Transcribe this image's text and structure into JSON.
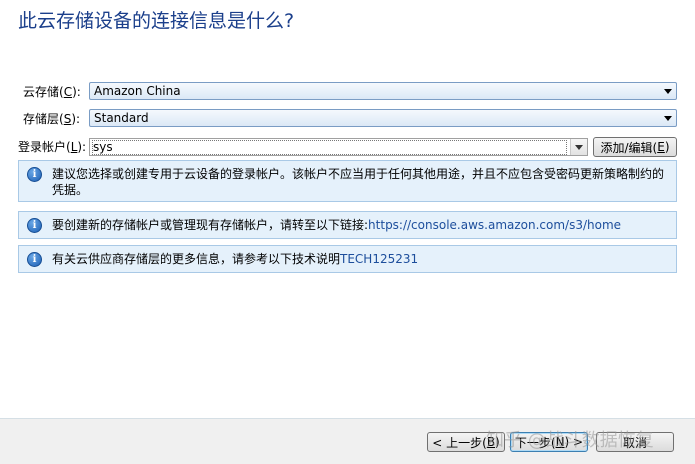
{
  "page": {
    "heading": "此云存储设备的连接信息是什么?"
  },
  "form": {
    "cloud_storage": {
      "label_prefix": "云存储(",
      "label_key": "C",
      "label_suffix": "):",
      "value": "Amazon China"
    },
    "storage_tier": {
      "label_prefix": "存储层(",
      "label_key": "S",
      "label_suffix": "):",
      "value": "Standard"
    },
    "login_account": {
      "label_prefix": "登录帐户(",
      "label_key": "L",
      "label_suffix": "):",
      "value": "sys"
    },
    "add_edit_button": {
      "label_prefix": "添加/编辑(",
      "label_key": "E",
      "label_suffix": ")"
    }
  },
  "info": [
    {
      "text": "建议您选择或创建专用于云设备的登录帐户。该帐户不应当用于任何其他用途，并且不应包含受密码更新策略制约的凭据。"
    },
    {
      "text": "要创建新的存储帐户或管理现有存储帐户，请转至以下链接:",
      "link": "https://console.aws.amazon.com/s3/home"
    },
    {
      "text": "有关云供应商存储层的更多信息，请参考以下技术说明",
      "link": "TECH125231"
    }
  ],
  "footer": {
    "back_button": {
      "label_prefix": "< 上一步(",
      "label_key": "B",
      "label_suffix": ")"
    },
    "next_button": {
      "label_prefix": "下一步(",
      "label_key": "N",
      "label_suffix": ") >"
    },
    "cancel_button": {
      "label": "取消"
    },
    "watermark": "知乎 @战斗数据恢复"
  },
  "colors": {
    "heading": "#1b3f8b",
    "info_bg": "#e5f1fb",
    "link": "#1d4e9c"
  }
}
